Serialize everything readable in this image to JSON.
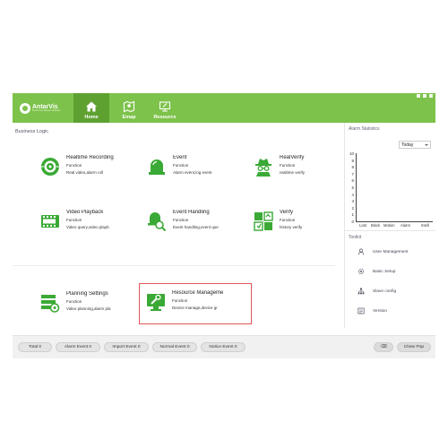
{
  "brand": {
    "name": "AntarVis",
    "tagline": "Smart Surveillance Software"
  },
  "nav": [
    {
      "label": "Home",
      "icon": "home-icon",
      "active": true
    },
    {
      "label": "Emap",
      "icon": "map-icon",
      "active": false
    },
    {
      "label": "Resource",
      "icon": "resource-icon",
      "active": false
    }
  ],
  "panel": {
    "title": "Business Logic"
  },
  "tiles": [
    {
      "name": "Realtime Recording",
      "func": "Function",
      "desc": "Real video,alarm roll",
      "icon": "camera-icon"
    },
    {
      "name": "Event",
      "func": "Function",
      "desc": "Alarm event,log event",
      "icon": "alarm-light-icon"
    },
    {
      "name": "RealVerify",
      "func": "Function",
      "desc": "realtime verify",
      "icon": "spy-icon"
    },
    {
      "name": "Video Playback",
      "func": "Function",
      "desc": "Video query,video playb",
      "icon": "film-icon"
    },
    {
      "name": "Event Handling",
      "func": "Function",
      "desc": "Event handling,event que",
      "icon": "magnifier-light-icon"
    },
    {
      "name": "Verify",
      "func": "Function",
      "desc": "history verify",
      "icon": "verify-grid-icon"
    },
    {
      "name": "Planning Settings",
      "func": "Function",
      "desc": "Video planning,alarm pla",
      "icon": "planning-icon"
    },
    {
      "name": "Resource Manageme",
      "func": "Function",
      "desc": "Device manage,device gr",
      "icon": "monitor-wrench-icon"
    }
  ],
  "alarm_stats": {
    "title": "Alarm Statistics",
    "range_selected": "Today",
    "y_ticks": [
      "10",
      "9",
      "8",
      "7",
      "6",
      "5",
      "4",
      "3",
      "2",
      "1",
      "0"
    ],
    "categories": [
      "Lost",
      "Block",
      "Motion",
      "Alarm",
      "Intell"
    ]
  },
  "toolkit": {
    "title": "Toolkit",
    "items": [
      {
        "label": "User Management",
        "icon": "user-icon"
      },
      {
        "label": "Basic Setup",
        "icon": "gear-icon"
      },
      {
        "label": "Slave config",
        "icon": "network-icon"
      },
      {
        "label": "Version",
        "icon": "version-icon"
      }
    ]
  },
  "status": {
    "counters": [
      {
        "label": "Total  0"
      },
      {
        "label": "Alarm Event  0"
      },
      {
        "label": "Import Event  0"
      },
      {
        "label": "Normal Event  0"
      },
      {
        "label": "Notice Event  0"
      }
    ],
    "clear_label": "⌫",
    "close_pop_label": "Close Pop"
  },
  "colors": {
    "brand_green": "#7dc24a",
    "active_tab": "#5fa131",
    "icon_green": "#3aa935",
    "selection_red": "#e05656"
  }
}
